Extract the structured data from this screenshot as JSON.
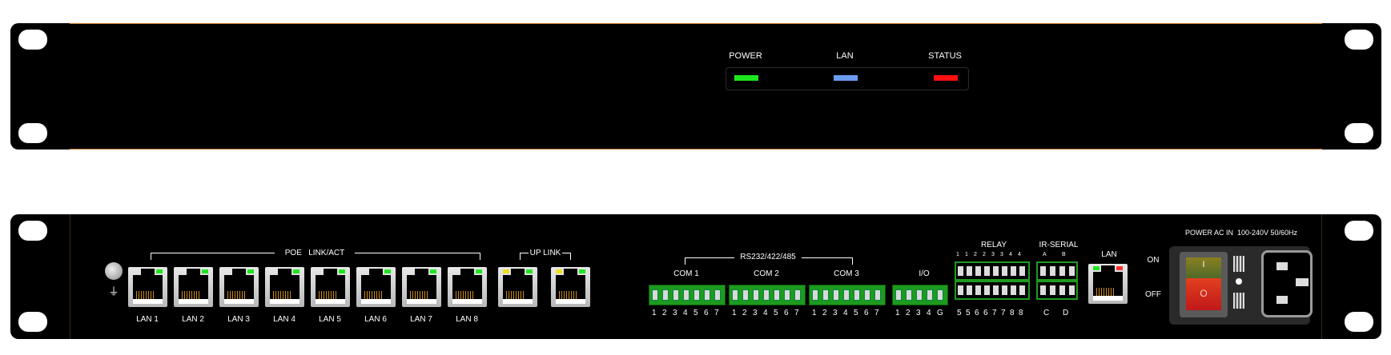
{
  "front": {
    "indicators": [
      {
        "label": "POWER",
        "color": "#1ee61e"
      },
      {
        "label": "LAN",
        "color": "#6a9cf0"
      },
      {
        "label": "STATUS",
        "color": "#ff1010"
      }
    ]
  },
  "rear": {
    "poe_group_label": "POE   LINK/ACT",
    "uplink_label": "UP LINK",
    "lan_ports": [
      "LAN 1",
      "LAN 2",
      "LAN 3",
      "LAN 4",
      "LAN 5",
      "LAN 6",
      "LAN 7",
      "LAN 8"
    ],
    "rs_group_label": "RS232/422/485",
    "com_blocks": [
      {
        "label": "COM 1",
        "pins": [
          "1",
          "2",
          "3",
          "4",
          "5",
          "6",
          "7"
        ]
      },
      {
        "label": "COM 2",
        "pins": [
          "1",
          "2",
          "3",
          "4",
          "5",
          "6",
          "7"
        ]
      },
      {
        "label": "COM 3",
        "pins": [
          "1",
          "2",
          "3",
          "4",
          "5",
          "6",
          "7"
        ]
      }
    ],
    "io": {
      "label": "I/O",
      "pins": [
        "1",
        "2",
        "3",
        "4",
        "G"
      ]
    },
    "relay": {
      "label": "RELAY",
      "top_pins": [
        "1",
        "1",
        "2",
        "2",
        "3",
        "3",
        "4",
        "4"
      ],
      "bottom_pins": [
        "5",
        "5",
        "6",
        "6",
        "7",
        "7",
        "8",
        "8"
      ]
    },
    "ir_serial": {
      "label": "IR-SERIAL",
      "top_pins": [
        "A",
        "B"
      ],
      "bottom_pins": [
        "C",
        "D"
      ]
    },
    "lan_label": "LAN",
    "switch_on": "ON",
    "switch_off": "OFF",
    "power_label": "POWER AC IN  100-240V 50/60Hz",
    "switch_on_symbol": "I",
    "switch_off_symbol": "O",
    "ground_symbol": "⏚"
  }
}
